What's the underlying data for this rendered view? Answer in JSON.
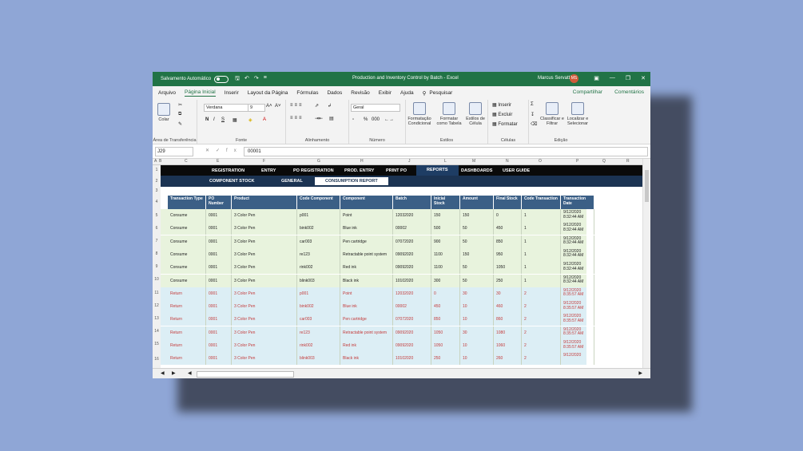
{
  "titlebar": {
    "autosave": "Salvamento Automático",
    "doc_title": "Production and Inventory Control by Batch  -  Excel",
    "user": "Marcus Servatti",
    "initials": "MS"
  },
  "menu": [
    "Arquivo",
    "Página Inicial",
    "Inserir",
    "Layout da Página",
    "Fórmulas",
    "Dados",
    "Revisão",
    "Exibir",
    "Ajuda",
    "Pesquisar"
  ],
  "share": "Compartilhar",
  "comments": "Comentários",
  "ribbon": {
    "clipboard": {
      "paste": "Colar",
      "label": "Área de Transferência"
    },
    "font": {
      "name": "Verdana",
      "size": "9",
      "label": "Fonte",
      "bold": "N",
      "italic": "I",
      "underline": "S"
    },
    "alignment": {
      "label": "Alinhamento"
    },
    "number": {
      "format": "Geral",
      "label": "Número",
      "percent": "%"
    },
    "styles": {
      "cond": "Formatação Condicional",
      "table": "Formatar como Tabela",
      "cell": "Estilos de Célula",
      "label": "Estilos"
    },
    "cells": {
      "insert": "Inserir",
      "delete": "Excluir",
      "format": "Formatar",
      "label": "Células"
    },
    "editing": {
      "sort": "Classificar e Filtrar",
      "find": "Localizar e Selecionar",
      "label": "Edição"
    }
  },
  "formula": {
    "name_box": "J29",
    "value": "00001"
  },
  "columns": [
    "A",
    "B",
    "C",
    "E",
    "F",
    "G",
    "H",
    "J",
    "L",
    "M",
    "N",
    "O",
    "P",
    "Q",
    "R"
  ],
  "nav_top": [
    "REGISTRATION",
    "ENTRY",
    "PO REGISTRATION",
    "PROD. ENTRY",
    "PRINT PO",
    "REPORTS",
    "DASHBOARDS",
    "USER GUIDE"
  ],
  "nav_sub": [
    "COMPONENT STOCK",
    "GENERAL",
    "CONSUMPTION REPORT"
  ],
  "headers": [
    "Transaction Type",
    "PO Number",
    "Product",
    "Code Component",
    "Component",
    "Batch",
    "Inicial Stock",
    "Amount",
    "Final Stock",
    "Code Transaction",
    "Transaction Date"
  ],
  "rows": [
    {
      "type": "Consume",
      "po": "0001",
      "product": "3 Color Pen",
      "code": "p001",
      "component": "Point",
      "batch": "12032020",
      "initial": "150",
      "amount": "150",
      "final": "0",
      "tcode": "1",
      "date": "9/12/2020 8:32:44 AM"
    },
    {
      "type": "Consume",
      "po": "0001",
      "product": "3 Color Pen",
      "code": "bink002",
      "component": "Blue ink",
      "batch": "00002",
      "initial": "500",
      "amount": "50",
      "final": "450",
      "tcode": "1",
      "date": "9/12/2020 8:32:44 AM"
    },
    {
      "type": "Consume",
      "po": "0001",
      "product": "3 Color Pen",
      "code": "car003",
      "component": "Pen cartridge",
      "batch": "07072020",
      "initial": "900",
      "amount": "50",
      "final": "850",
      "tcode": "1",
      "date": "9/12/2020 8:32:44 AM"
    },
    {
      "type": "Consume",
      "po": "0001",
      "product": "3 Color Pen",
      "code": "re123",
      "component": "Retractable point system",
      "batch": "09092020",
      "initial": "1100",
      "amount": "150",
      "final": "950",
      "tcode": "1",
      "date": "9/12/2020 8:32:44 AM"
    },
    {
      "type": "Consume",
      "po": "0001",
      "product": "3 Color Pen",
      "code": "rink002",
      "component": "Red ink",
      "batch": "09092020",
      "initial": "1100",
      "amount": "50",
      "final": "1050",
      "tcode": "1",
      "date": "9/12/2020 8:32:44 AM"
    },
    {
      "type": "Consume",
      "po": "0001",
      "product": "3 Color Pen",
      "code": "blink003",
      "component": "Black ink",
      "batch": "10102020",
      "initial": "300",
      "amount": "50",
      "final": "250",
      "tcode": "1",
      "date": "9/12/2020 8:32:44 AM"
    },
    {
      "type": "Return",
      "po": "0001",
      "product": "3 Color Pen",
      "code": "p001",
      "component": "Point",
      "batch": "12032020",
      "initial": "0",
      "amount": "30",
      "final": "30",
      "tcode": "2",
      "date": "9/12/2020 8:35:57 AM"
    },
    {
      "type": "Return",
      "po": "0001",
      "product": "3 Color Pen",
      "code": "bink002",
      "component": "Blue ink",
      "batch": "00002",
      "initial": "450",
      "amount": "10",
      "final": "460",
      "tcode": "2",
      "date": "9/12/2020 8:35:57 AM"
    },
    {
      "type": "Return",
      "po": "0001",
      "product": "3 Color Pen",
      "code": "car003",
      "component": "Pen cartridge",
      "batch": "07072020",
      "initial": "850",
      "amount": "10",
      "final": "860",
      "tcode": "2",
      "date": "9/12/2020 8:35:57 AM"
    },
    {
      "type": "Return",
      "po": "0001",
      "product": "3 Color Pen",
      "code": "re123",
      "component": "Retractable point system",
      "batch": "09092020",
      "initial": "1050",
      "amount": "30",
      "final": "1080",
      "tcode": "2",
      "date": "9/12/2020 8:35:57 AM"
    },
    {
      "type": "Return",
      "po": "0001",
      "product": "3 Color Pen",
      "code": "rink002",
      "component": "Red ink",
      "batch": "09092020",
      "initial": "1050",
      "amount": "10",
      "final": "1060",
      "tcode": "2",
      "date": "9/12/2020 8:35:57 AM"
    },
    {
      "type": "Return",
      "po": "0001",
      "product": "3 Color Pen",
      "code": "blink003",
      "component": "Black ink",
      "batch": "10102020",
      "initial": "250",
      "amount": "10",
      "final": "260",
      "tcode": "2",
      "date": "9/12/2020"
    }
  ],
  "row_numbers": [
    "1",
    "2",
    "3",
    "4",
    "5",
    "6",
    "7",
    "8",
    "9",
    "10",
    "11",
    "12",
    "13",
    "14",
    "15",
    "16"
  ],
  "colors": {
    "excel_green": "#217346",
    "nav_dark": "#0a0a0a",
    "nav_blue": "#1b3352",
    "header_blue": "#3b5f86",
    "consume_row": "#e8f3dd",
    "return_row": "#dceef5",
    "return_text": "#c43a3a"
  }
}
